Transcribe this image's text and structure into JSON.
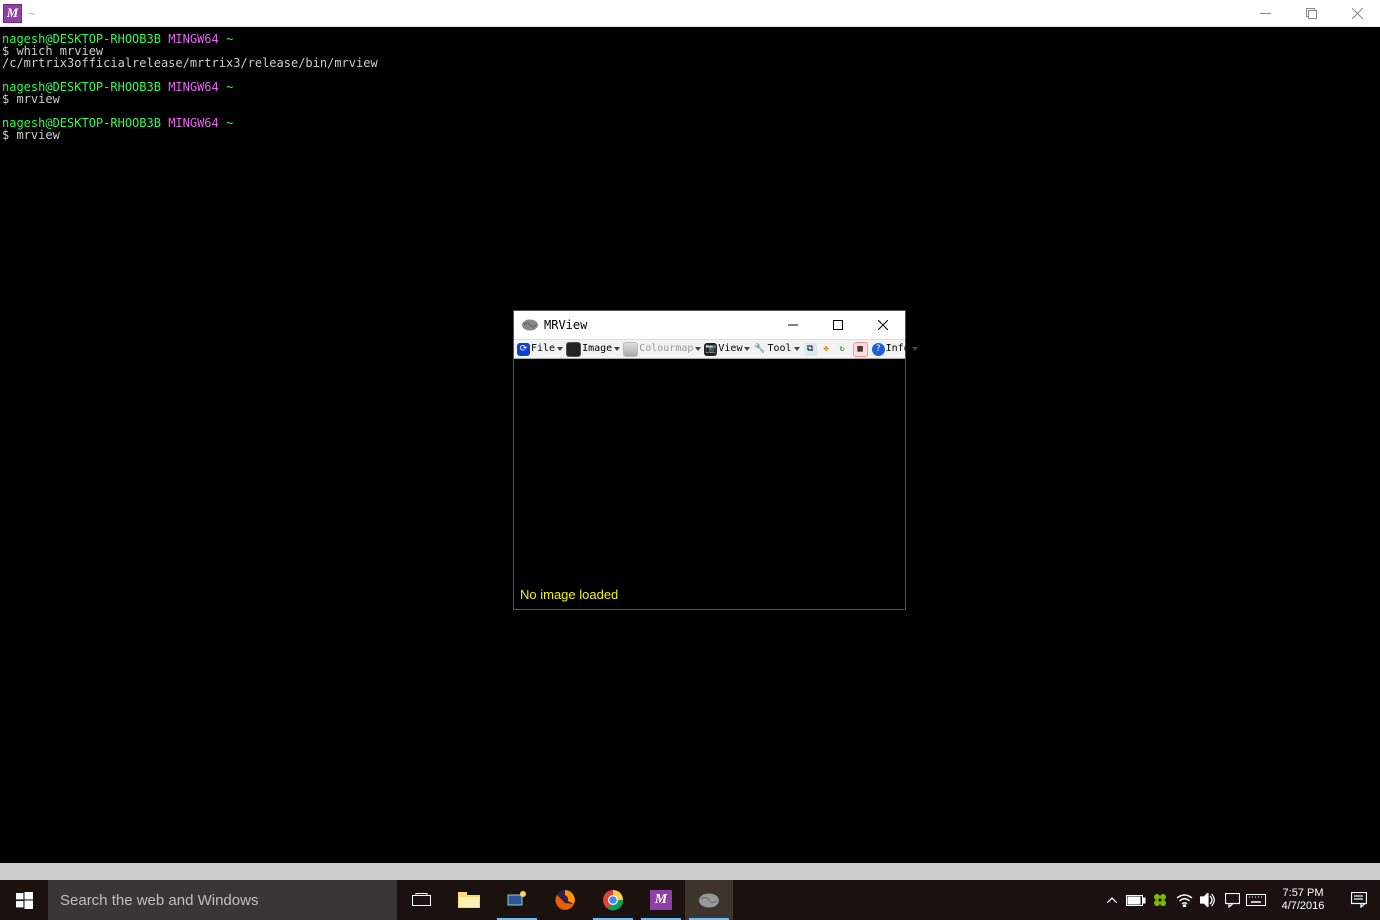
{
  "terminal_window": {
    "title_tilde": "~",
    "min": "—",
    "max": "❐",
    "close": "✕"
  },
  "terminal": {
    "user": "nagesh",
    "host": "DESKTOP-RHOOB3B",
    "shell": "MINGW64",
    "cwd": "~",
    "prompt_char": "$",
    "blocks": [
      {
        "cmd": "which mrview",
        "output": "/c/mrtrix3officialrelease/mrtrix3/release/bin/mrview"
      },
      {
        "cmd": "mrview",
        "output": ""
      },
      {
        "cmd": "mrview",
        "output": ""
      }
    ]
  },
  "mrview": {
    "title": "MRView",
    "status": "No image loaded",
    "toolbar": {
      "file": "File",
      "image": "Image",
      "colourmap": "Colourmap",
      "view": "View",
      "tool": "Tool",
      "info": "Info"
    }
  },
  "taskbar": {
    "search_placeholder": "Search the web and Windows",
    "time": "7:57 PM",
    "date": "4/7/2016"
  }
}
